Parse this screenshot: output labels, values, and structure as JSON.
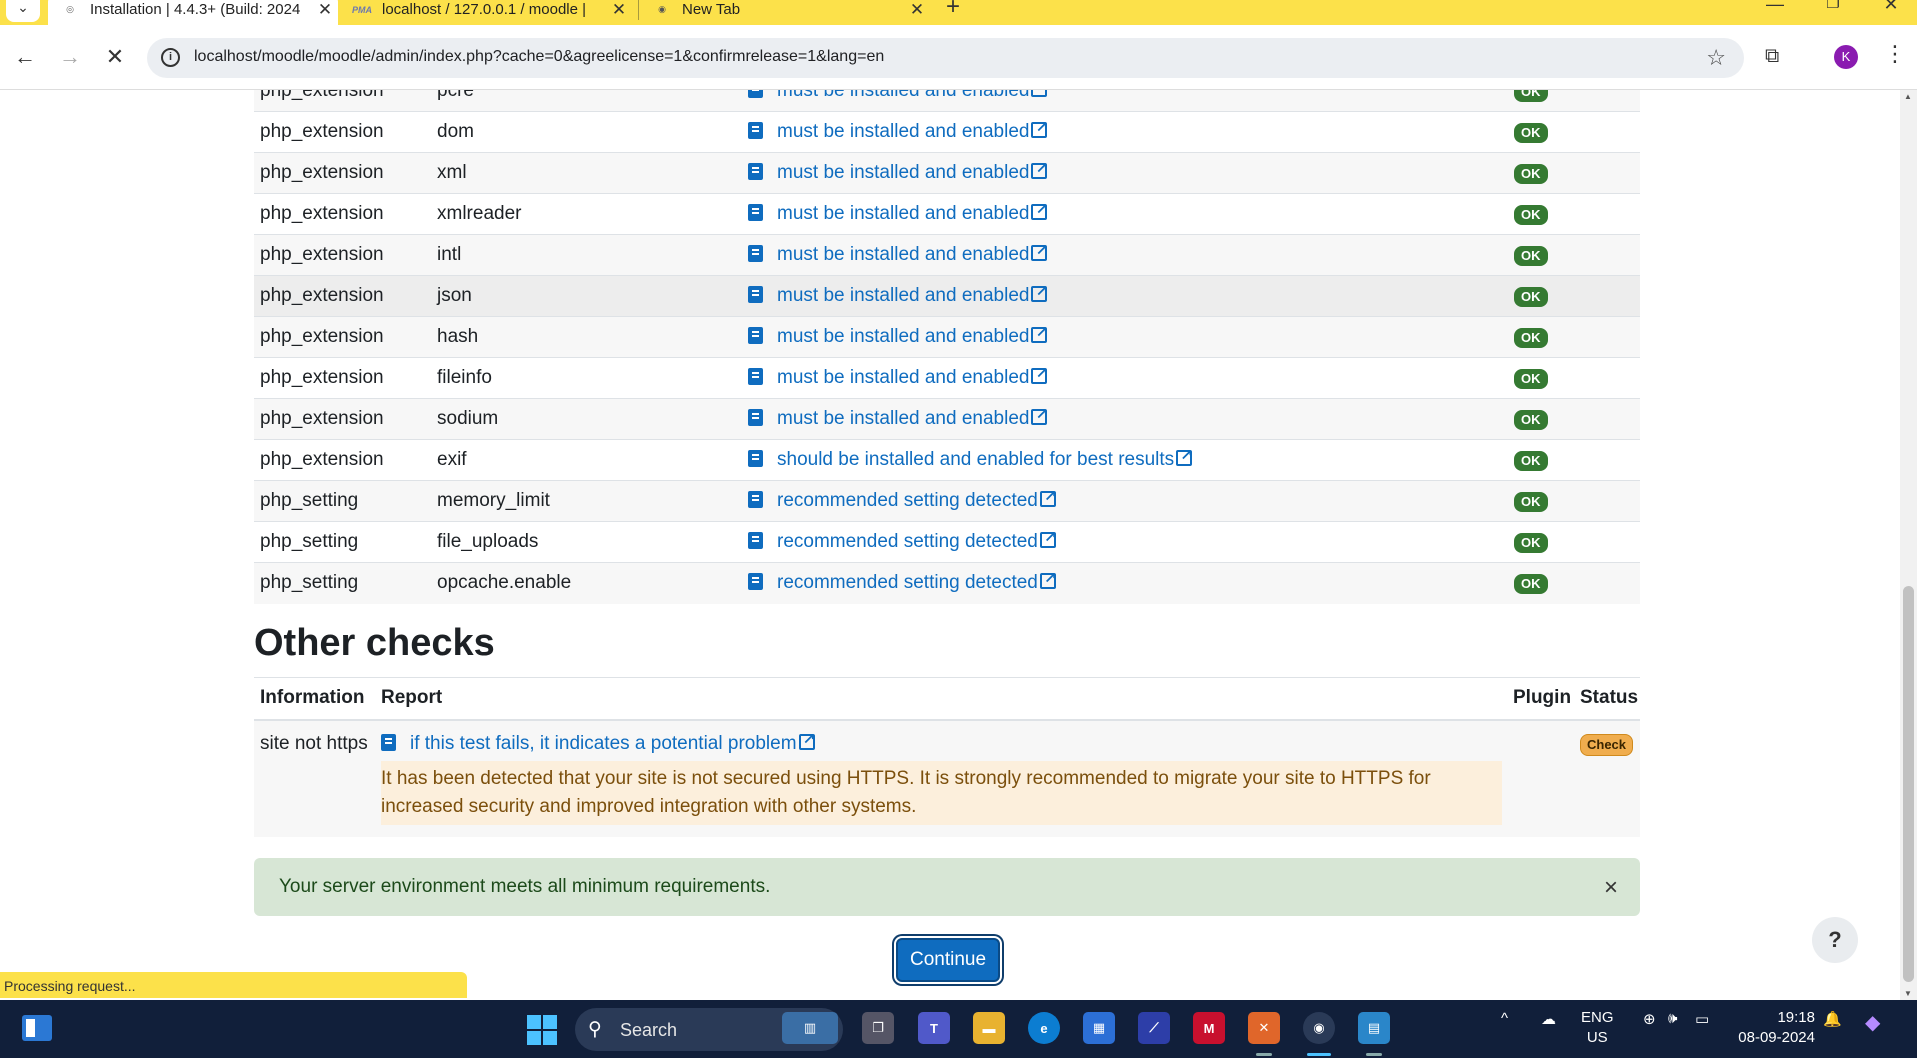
{
  "browser": {
    "tabs": [
      {
        "title": "Installation | 4.4.3+ (Build: 2024",
        "favicon": "moodle-icon"
      },
      {
        "title": "localhost / 127.0.0.1 / moodle |",
        "favicon": "phpmyadmin-icon",
        "favicon_text": "PMA"
      },
      {
        "title": "New Tab",
        "favicon": "chrome-icon"
      }
    ],
    "url": "localhost/moodle/moodle/admin/index.php?cache=0&agreelicense=1&confirmrelease=1&lang=en",
    "profile_initial": "K"
  },
  "env_rows": [
    {
      "type": "php_extension",
      "name": "pcre",
      "report": "must be installed and enabled",
      "status": "OK"
    },
    {
      "type": "php_extension",
      "name": "dom",
      "report": "must be installed and enabled",
      "status": "OK"
    },
    {
      "type": "php_extension",
      "name": "xml",
      "report": "must be installed and enabled",
      "status": "OK"
    },
    {
      "type": "php_extension",
      "name": "xmlreader",
      "report": "must be installed and enabled",
      "status": "OK"
    },
    {
      "type": "php_extension",
      "name": "intl",
      "report": "must be installed and enabled",
      "status": "OK"
    },
    {
      "type": "php_extension",
      "name": "json",
      "report": "must be installed and enabled",
      "status": "OK"
    },
    {
      "type": "php_extension",
      "name": "hash",
      "report": "must be installed and enabled",
      "status": "OK"
    },
    {
      "type": "php_extension",
      "name": "fileinfo",
      "report": "must be installed and enabled",
      "status": "OK"
    },
    {
      "type": "php_extension",
      "name": "sodium",
      "report": "must be installed and enabled",
      "status": "OK"
    },
    {
      "type": "php_extension",
      "name": "exif",
      "report": "should be installed and enabled for best results",
      "status": "OK"
    },
    {
      "type": "php_setting",
      "name": "memory_limit",
      "report": "recommended setting detected",
      "status": "OK"
    },
    {
      "type": "php_setting",
      "name": "file_uploads",
      "report": "recommended setting detected",
      "status": "OK"
    },
    {
      "type": "php_setting",
      "name": "opcache.enable",
      "report": "recommended setting detected",
      "status": "OK"
    }
  ],
  "other_checks": {
    "heading": "Other checks",
    "headers": {
      "information": "Information",
      "report": "Report",
      "plugin": "Plugin",
      "status": "Status"
    },
    "row": {
      "information": "site not https",
      "report_link": "if this test fails, it indicates a potential problem",
      "warning": "It has been detected that your site is not secured using HTTPS. It is strongly recommended to migrate your site to HTTPS for increased security and improved integration with other systems.",
      "plugin": "",
      "status": "Check"
    }
  },
  "alert": {
    "text": "Your server environment meets all minimum requirements.",
    "close": "×"
  },
  "continue_label": "Continue",
  "help_label": "?",
  "status_bar": "Processing request...",
  "taskbar": {
    "search_label": "Search",
    "lang_line1": "ENG",
    "lang_line2": "US",
    "time": "19:18",
    "date": "08-09-2024"
  }
}
